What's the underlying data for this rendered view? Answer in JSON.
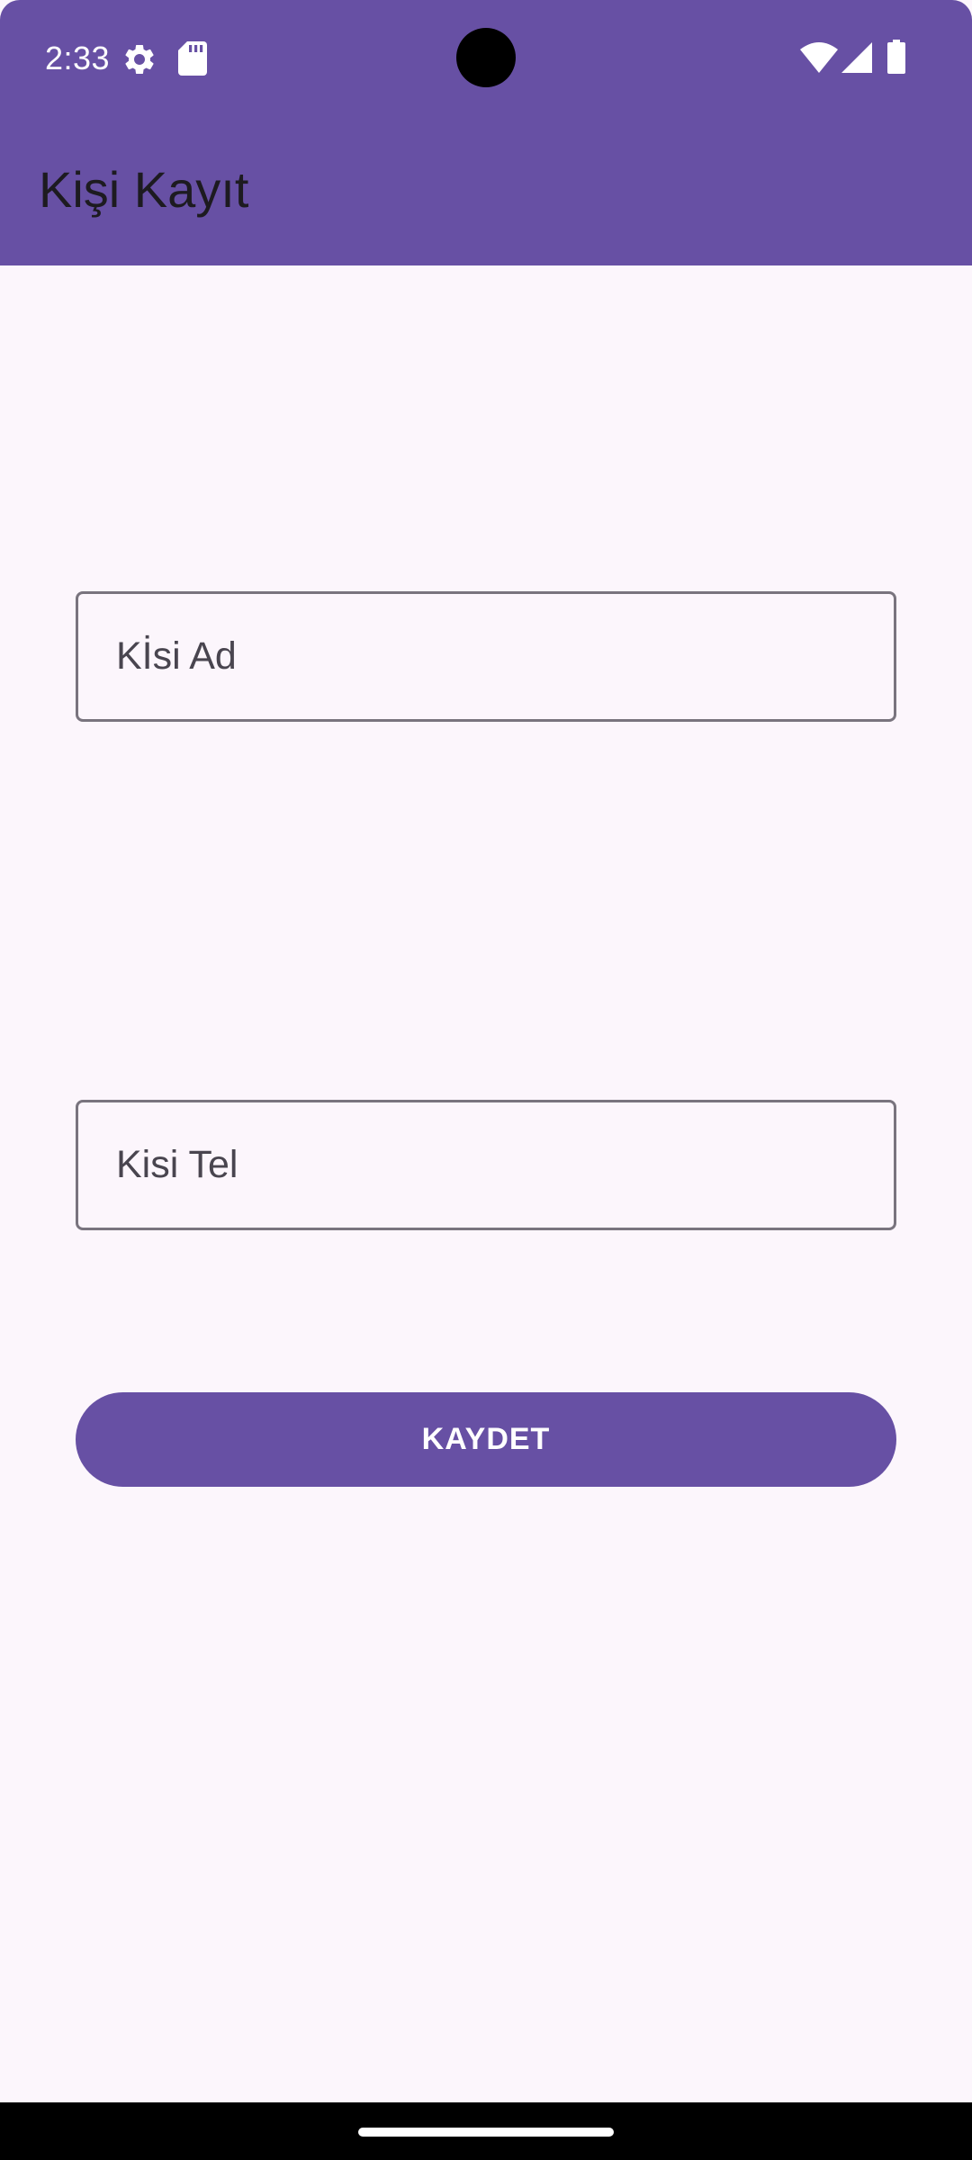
{
  "status_bar": {
    "time": "2:33",
    "left_icons": [
      "settings-icon",
      "sd-card-icon"
    ],
    "right_icons": [
      "wifi-icon",
      "cellular-signal-icon",
      "battery-icon"
    ]
  },
  "app_bar": {
    "title": "Kişi Kayıt",
    "color": "#6750a4"
  },
  "form": {
    "name_field": {
      "placeholder": "Kİsi Ad"
    },
    "phone_field": {
      "placeholder": "Kisi Tel"
    },
    "save_label": "KAYDET"
  },
  "colors": {
    "primary": "#6750a4",
    "background": "#fcf6fc",
    "outline": "#79747e"
  }
}
